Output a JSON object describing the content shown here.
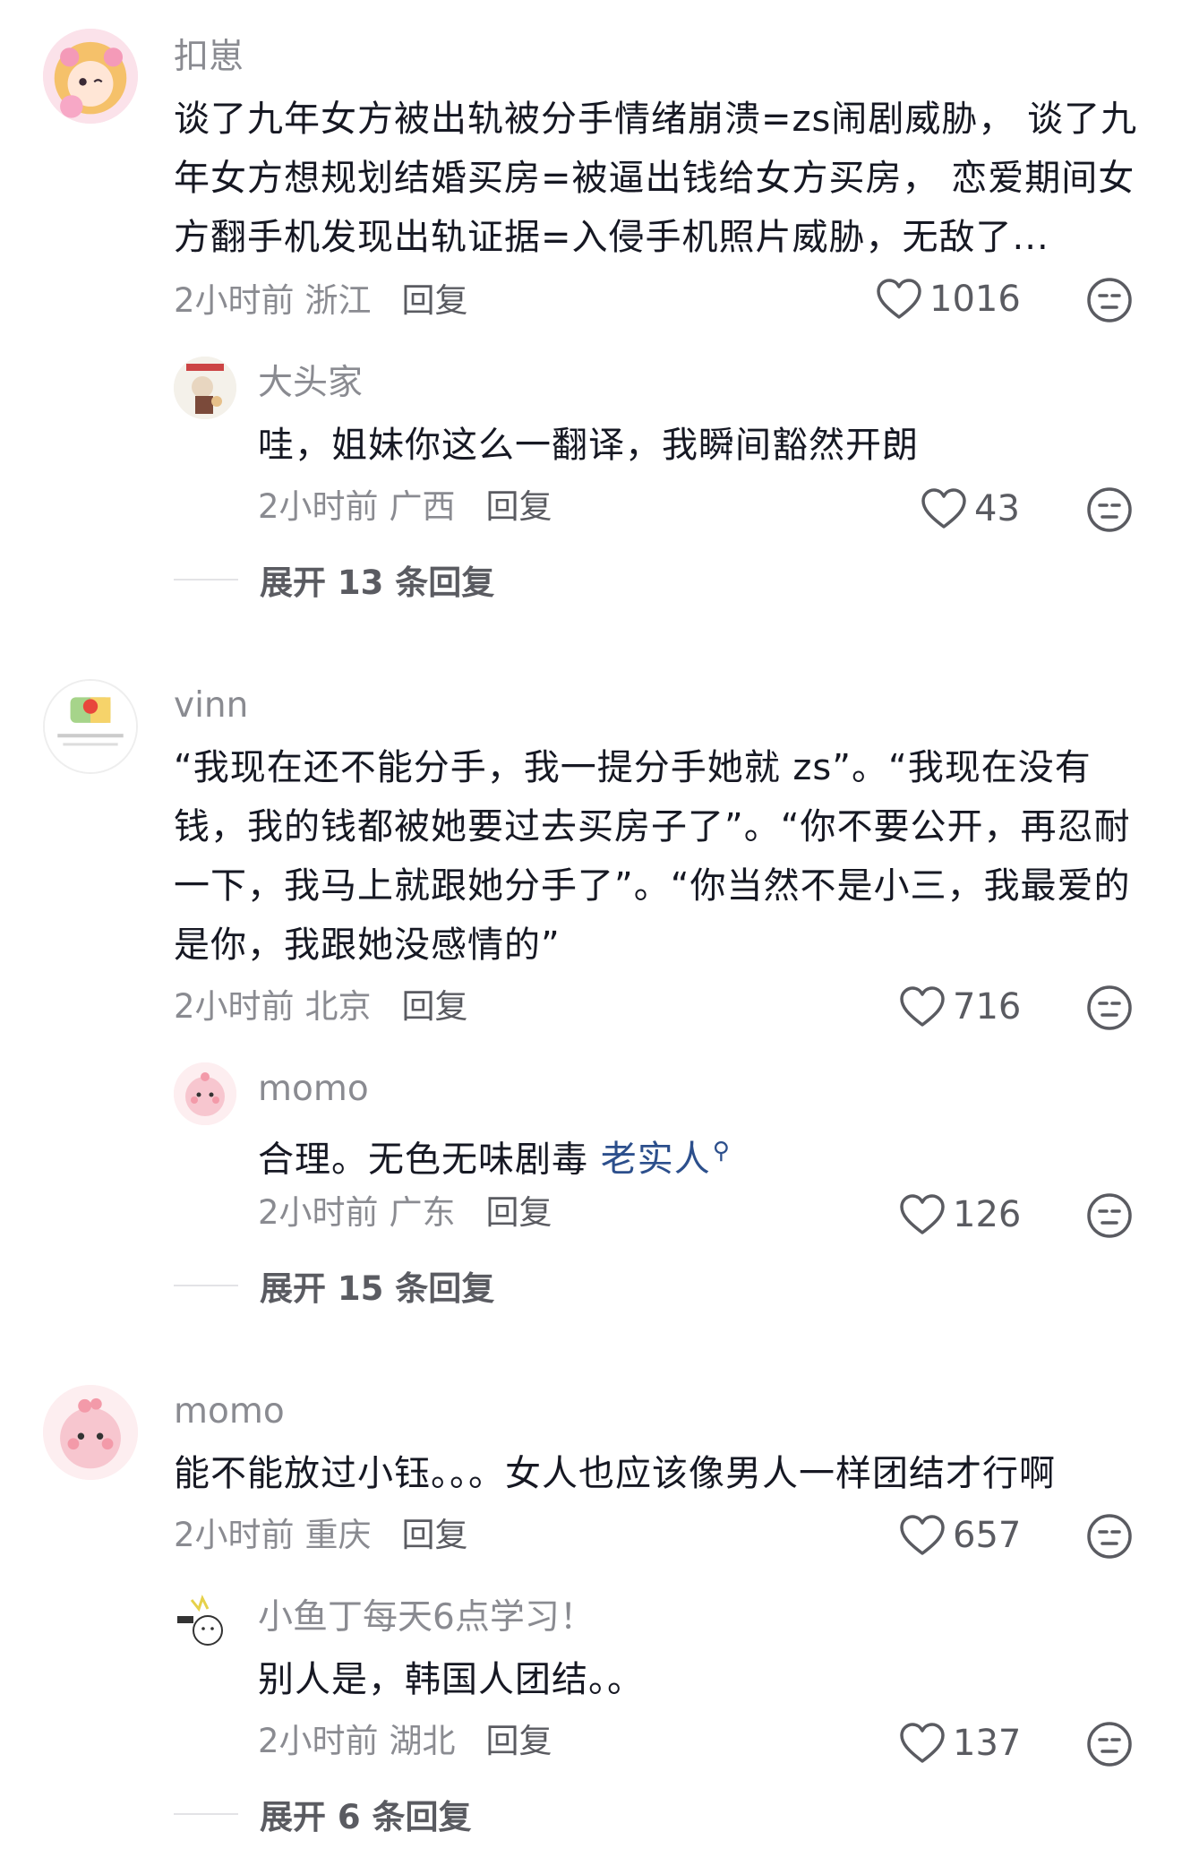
{
  "comments": [
    {
      "username": "扣崽",
      "text": "谈了九年女方被出轨被分手情绪崩溃=zs闹剧威胁， 谈了九年女方想规划结婚买房=被逼出钱给女方买房， 恋爱期间女方翻手机发现出轨证据=入侵手机照片威胁，无敌了...",
      "time": "2小时前",
      "location": "浙江",
      "reply_label": "回复",
      "likes": "1016",
      "reply": {
        "username": "大头家",
        "text": "哇，姐妹你这么一翻译，我瞬间豁然开朗",
        "time": "2小时前",
        "location": "广西",
        "reply_label": "回复",
        "likes": "43"
      },
      "expand_label": "展开 13 条回复"
    },
    {
      "username": "vinn",
      "text": "“我现在还不能分手，我一提分手她就 zs”。“我现在没有钱，我的钱都被她要过去买房子了”。“你不要公开，再忍耐一下，我马上就跟她分手了”。“你当然不是小三，我最爱的是你，我跟她没感情的”",
      "time": "2小时前",
      "location": "北京",
      "reply_label": "回复",
      "likes": "716",
      "reply": {
        "username": "momo",
        "text": "合理。无色无味剧毒 ",
        "link": "老实人",
        "time": "2小时前",
        "location": "广东",
        "reply_label": "回复",
        "likes": "126"
      },
      "expand_label": "展开 15 条回复"
    },
    {
      "username": "momo",
      "text": "能不能放过小钰。。。女人也应该像男人一样团结才行啊",
      "time": "2小时前",
      "location": "重庆",
      "reply_label": "回复",
      "likes": "657",
      "reply": {
        "username": "小鱼丁每天6点学习！",
        "text": "别人是，韩国人团结。。",
        "time": "2小时前",
        "location": "湖北",
        "reply_label": "回复",
        "likes": "137"
      },
      "expand_label": "展开 6 条回复"
    }
  ],
  "icons": {
    "like": "heart-outline-icon",
    "dislike": "meh-face-icon",
    "link_search": "search-icon"
  },
  "colors": {
    "text": "#161823",
    "secondary": "#8a8b91",
    "link": "#2c4f8c",
    "divider": "#e3e3e6"
  }
}
